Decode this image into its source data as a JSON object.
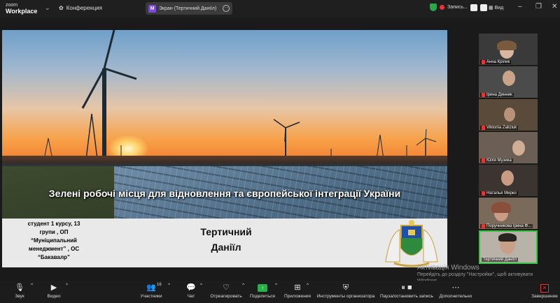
{
  "app": {
    "brand_top": "zoom",
    "brand_bottom": "Workplace"
  },
  "meeting": {
    "title": "Конференция"
  },
  "share": {
    "badge": "M",
    "label": "Экран (Тертичний Даніїл)"
  },
  "recording": {
    "label": "Запись..."
  },
  "view": {
    "label": "Вид"
  },
  "slide": {
    "title": "Зелені робочі місця для відновлення та європейської інтеграції України",
    "student_lines": [
      "студент 1 курсу, 13",
      "групи , ОП",
      "“Муніципальний",
      "менеджмент” , ОС",
      "“Бакавалр”"
    ],
    "name_lines": [
      "Тертичний",
      "Даніїл"
    ]
  },
  "participants": [
    {
      "name": "Анна Крілик",
      "muted": true
    },
    {
      "name": "Ірина Динник",
      "muted": true
    },
    {
      "name": "Viktoriia Zaliziuk",
      "muted": true
    },
    {
      "name": "Юлія Музика",
      "muted": true
    },
    {
      "name": "Наталья Мирко",
      "muted": true
    },
    {
      "name": "Поручникова Ірина Ф...",
      "muted": true
    },
    {
      "name": "Тертичний Даніїл",
      "muted": false,
      "active": true
    }
  ],
  "windows": {
    "line1": "Активація Windows",
    "line2": "Перейдіть до розділу \"Настройки\", щоб активувати",
    "line3": "Windows."
  },
  "toolbar": {
    "audio": "Звук",
    "video": "Видео",
    "participants": "Участники",
    "participants_count": "16",
    "chat": "Чат",
    "react": "Отреагировать",
    "share": "Поделиться",
    "apps": "Приложения",
    "host_tools": "Инструменты организатора",
    "pause_rec": "Пауза/остановить запись",
    "more": "Дополнительно",
    "end": "Завершение"
  },
  "colors": {
    "share_green": "#27b14a",
    "end_red": "#e33333",
    "active_border": "#37c442"
  }
}
